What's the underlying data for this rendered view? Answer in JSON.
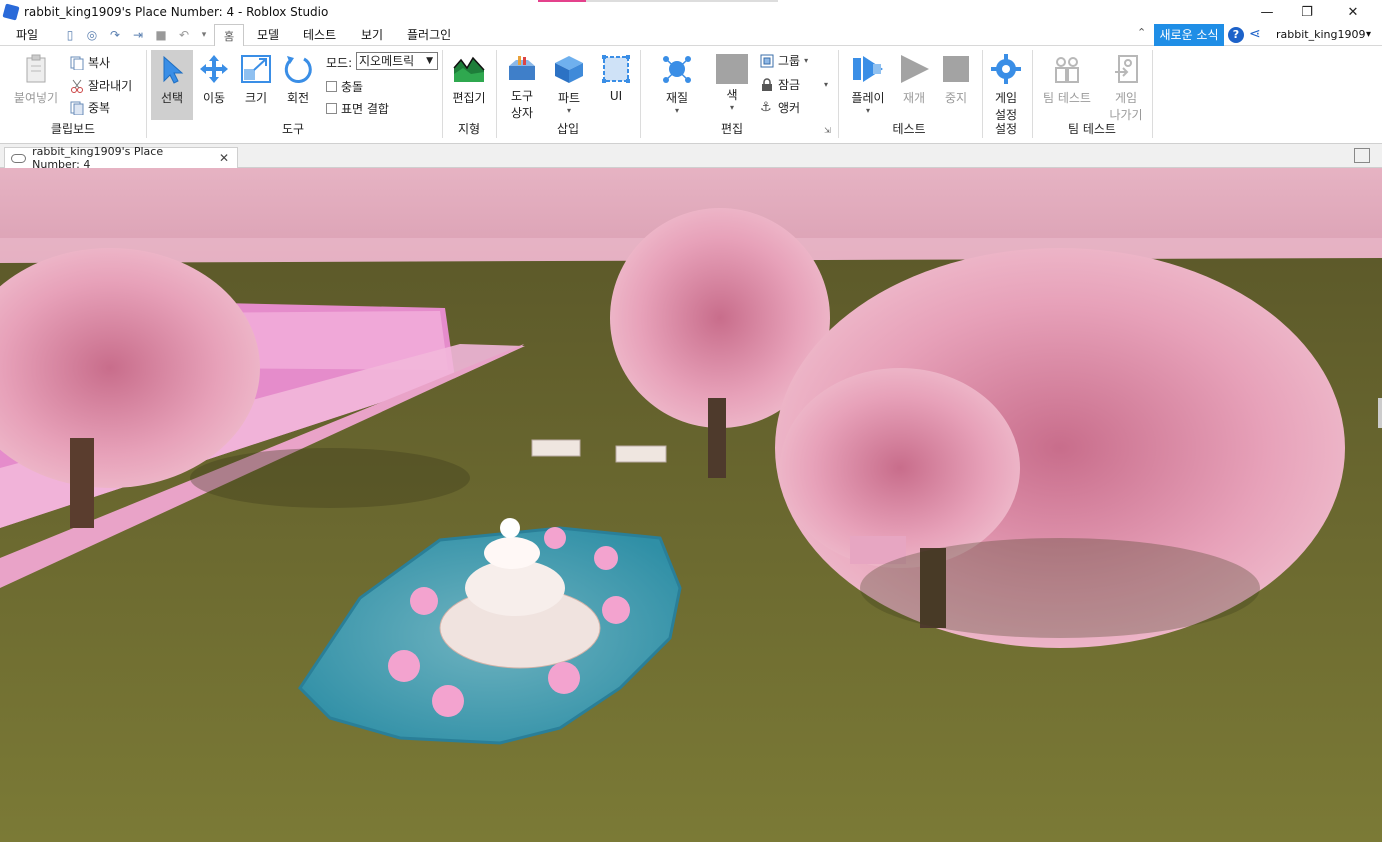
{
  "window": {
    "title": "rabbit_king1909's Place Number: 4 - Roblox Studio",
    "minimize": "—",
    "restore": "❐",
    "close": "✕"
  },
  "menu": {
    "file": "파일",
    "home_tab": "홈",
    "tabs": [
      "모델",
      "테스트",
      "보기",
      "플러그인"
    ],
    "news": "새로운 소식",
    "help": "?",
    "username": "rabbit_king1909",
    "user_caret": "▾"
  },
  "ribbon": {
    "clipboard": {
      "paste": "붙여넣기",
      "copy": "복사",
      "cut": "잘라내기",
      "duplicate": "중복",
      "label": "클립보드"
    },
    "tools": {
      "select": "선택",
      "move": "이동",
      "scale": "크기",
      "rotate": "회전",
      "mode_label": "모드:",
      "mode_value": "지오메트릭",
      "collisions": "충돌",
      "join_surfaces": "표면 결합",
      "label": "도구"
    },
    "terrain": {
      "editor": "편집기",
      "label": "지형"
    },
    "insert": {
      "toolbox_line1": "도구",
      "toolbox_line2": "상자",
      "part": "파트",
      "ui": "UI",
      "label": "삽입"
    },
    "edit": {
      "material": "재질",
      "color": "색",
      "group": "그룹",
      "lock": "잠금",
      "anchor": "앵커",
      "label": "편집"
    },
    "test": {
      "play": "플레이",
      "resume": "재개",
      "stop": "중지",
      "label": "테스트"
    },
    "settings": {
      "game_settings_line1": "게임",
      "game_settings_line2": "설정",
      "label": "설정"
    },
    "team_test": {
      "team_test": "팀 테스트",
      "exit_line1": "게임",
      "exit_line2": "나가기",
      "label": "팀 테스트"
    }
  },
  "document": {
    "tab_title": "rabbit_king1909's Place Number: 4",
    "tab_close": "✕"
  },
  "scene": {
    "description_colors": {
      "sky_top": "#e9b6c8",
      "sky_bottom": "#d79db0",
      "grass": "#6b6a2e",
      "pond": "#3f9fae",
      "blossom": "#e59bb4",
      "maze": "#ea8fcb"
    }
  }
}
